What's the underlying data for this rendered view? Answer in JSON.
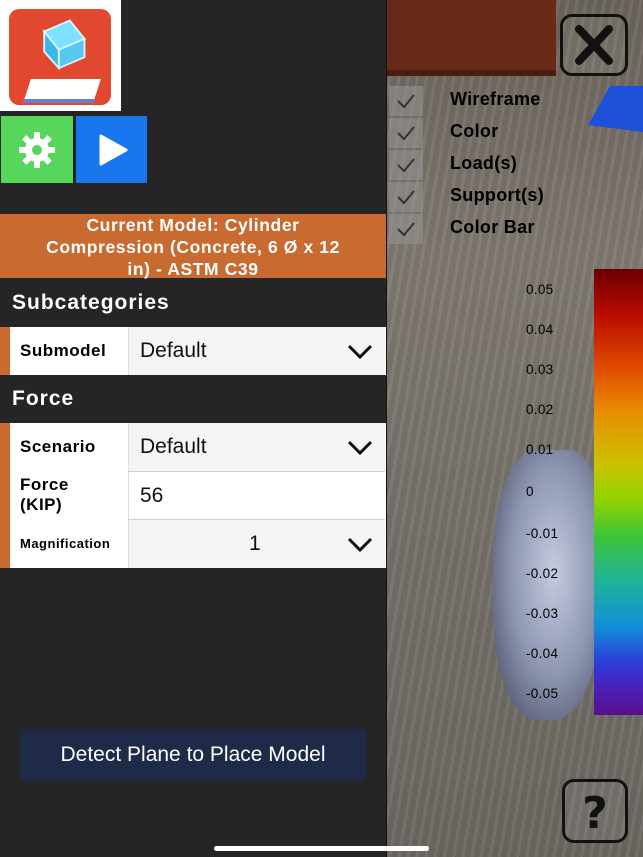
{
  "toolbar": {
    "logo": "app-logo",
    "settings_icon": "gear-icon",
    "play_icon": "play-icon"
  },
  "current_model": {
    "line1": "Current Model: Cylinder",
    "line2": "Compression (Concrete, 6 Ø x 12",
    "line3": "in) - ASTM C39"
  },
  "subcategories": {
    "title": "Subcategories",
    "submodel_label": "Submodel",
    "submodel_value": "Default"
  },
  "force": {
    "title": "Force",
    "scenario_label": "Scenario",
    "scenario_value": "Default",
    "force_label_line1": "Force",
    "force_label_line2": "(KIP)",
    "force_value": "56",
    "magnification_label": "Magnification",
    "magnification_value": "1"
  },
  "detect_button": "Detect Plane to Place Model",
  "overlay": {
    "toggles": [
      "Wireframe",
      "Color",
      "Load(s)",
      "Support(s)",
      "Color Bar"
    ],
    "close_icon": "close-icon",
    "help_icon": "help-icon",
    "colorbar_ticks": [
      "0.05",
      "0.04",
      "0.03",
      "0.02",
      "0.01",
      "0",
      "-0.01",
      "-0.02",
      "-0.03",
      "-0.04",
      "-0.05"
    ]
  },
  "colors": {
    "accent_orange": "#c96a30",
    "settings_green": "#56d65a",
    "play_blue": "#1a76ee",
    "panel_bg": "#252525",
    "detect_bg": "#1f2a48"
  }
}
